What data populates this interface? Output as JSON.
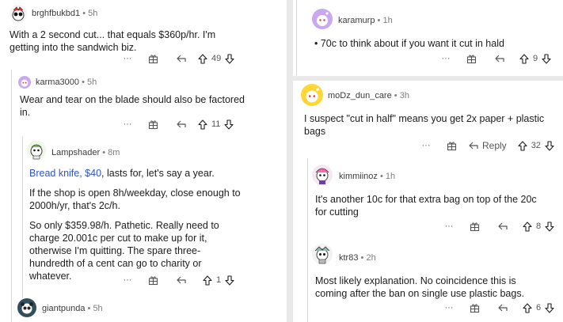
{
  "left": {
    "c1": {
      "author": "brghfbukbd1",
      "time": "5h",
      "lines": [
        "With a 2 second cut... that equals $360p/hr. I'm",
        "getting into the sandwich biz."
      ],
      "votes": "49"
    },
    "c2": {
      "author": "karma3000",
      "time": "5h",
      "lines": [
        "Wear and tear on the blade should also be factored",
        "in."
      ],
      "votes": "11"
    },
    "c3": {
      "author": "Lampshader",
      "time": "8m",
      "link_text": "Bread knife, $40",
      "p1_rest": ", lasts for, let's say a year.",
      "p2": [
        "If the shop is open 8h/weekday, close enough to",
        "2000h/yr, that's 2c/h."
      ],
      "p3": [
        "So only $359.98/h. Pathetic. Really need to",
        "charge 20.001c per cut to make up for it,",
        "otherwise I'm quitting. The spare three-",
        "hundredth of a cent can go to charity or",
        "whatever."
      ],
      "votes": "1"
    },
    "c4": {
      "author": "giantpunda",
      "time": "5h"
    }
  },
  "right": {
    "r1": {
      "author": "karamurp",
      "time": "1h",
      "lines": [
        "• 70c to think about if you want it cut in hald"
      ],
      "votes": "9"
    },
    "r2": {
      "author": "moDz_dun_care",
      "time": "3h",
      "lines": [
        "I suspect \"cut in half\" means you get 2x paper + plastic",
        "bags"
      ],
      "reply_label": "Reply",
      "votes": "32"
    },
    "r3": {
      "author": "kimmiinoz",
      "time": "1h",
      "lines": [
        "It's another 10c for that extra bag on top of the 20c",
        "for cutting"
      ],
      "votes": "8"
    },
    "r4": {
      "author": "ktr83",
      "time": "2h",
      "lines": [
        "Most likely explanation. No coincidence this is",
        "coming after the ban on single use plastic bags."
      ],
      "votes": "6"
    }
  },
  "separator": "•",
  "more_label": "···",
  "colors": {
    "panel": "#ffffff",
    "page": "#e9e9e9",
    "link": "#2f55c4",
    "upvote": "#1c1c1c",
    "avatar_yellow": "#ffd635",
    "avatar_purple": "#c9a8f0",
    "avatar_pink": "#ff66ac"
  }
}
